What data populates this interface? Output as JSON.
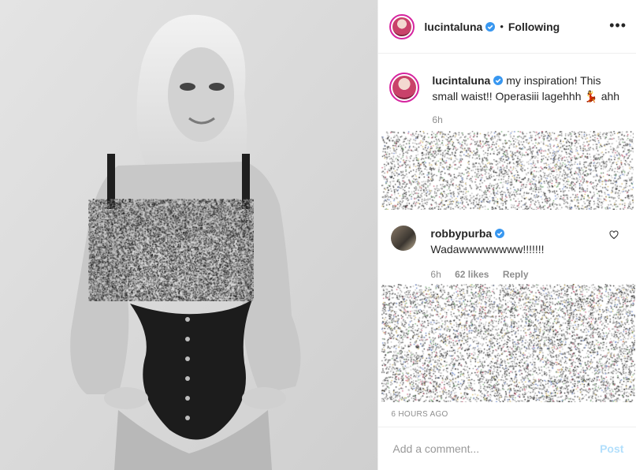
{
  "post": {
    "username": "lucintaluna",
    "follow_status": "Following",
    "more_glyph": "•••"
  },
  "caption": {
    "username": "lucintaluna",
    "text": "my inspiration! This small waist!! Operasiii lagehhh 💃 ahh",
    "time": "6h"
  },
  "comment": {
    "username": "robbypurba",
    "text": "Wadawwwwwwww!!!!!!!",
    "time": "6h",
    "likes": "62 likes",
    "reply_label": "Reply"
  },
  "timestamp": "6 HOURS AGO",
  "add_comment": {
    "placeholder": "Add a comment...",
    "post_label": "Post"
  },
  "colors": {
    "verified": "#3897f0",
    "muted": "#8e8e8e",
    "post_disabled": "#b2dffc",
    "story_ring": "#d6249f"
  },
  "icons": [
    "verified-badge-icon",
    "more-options-icon",
    "heart-icon"
  ]
}
